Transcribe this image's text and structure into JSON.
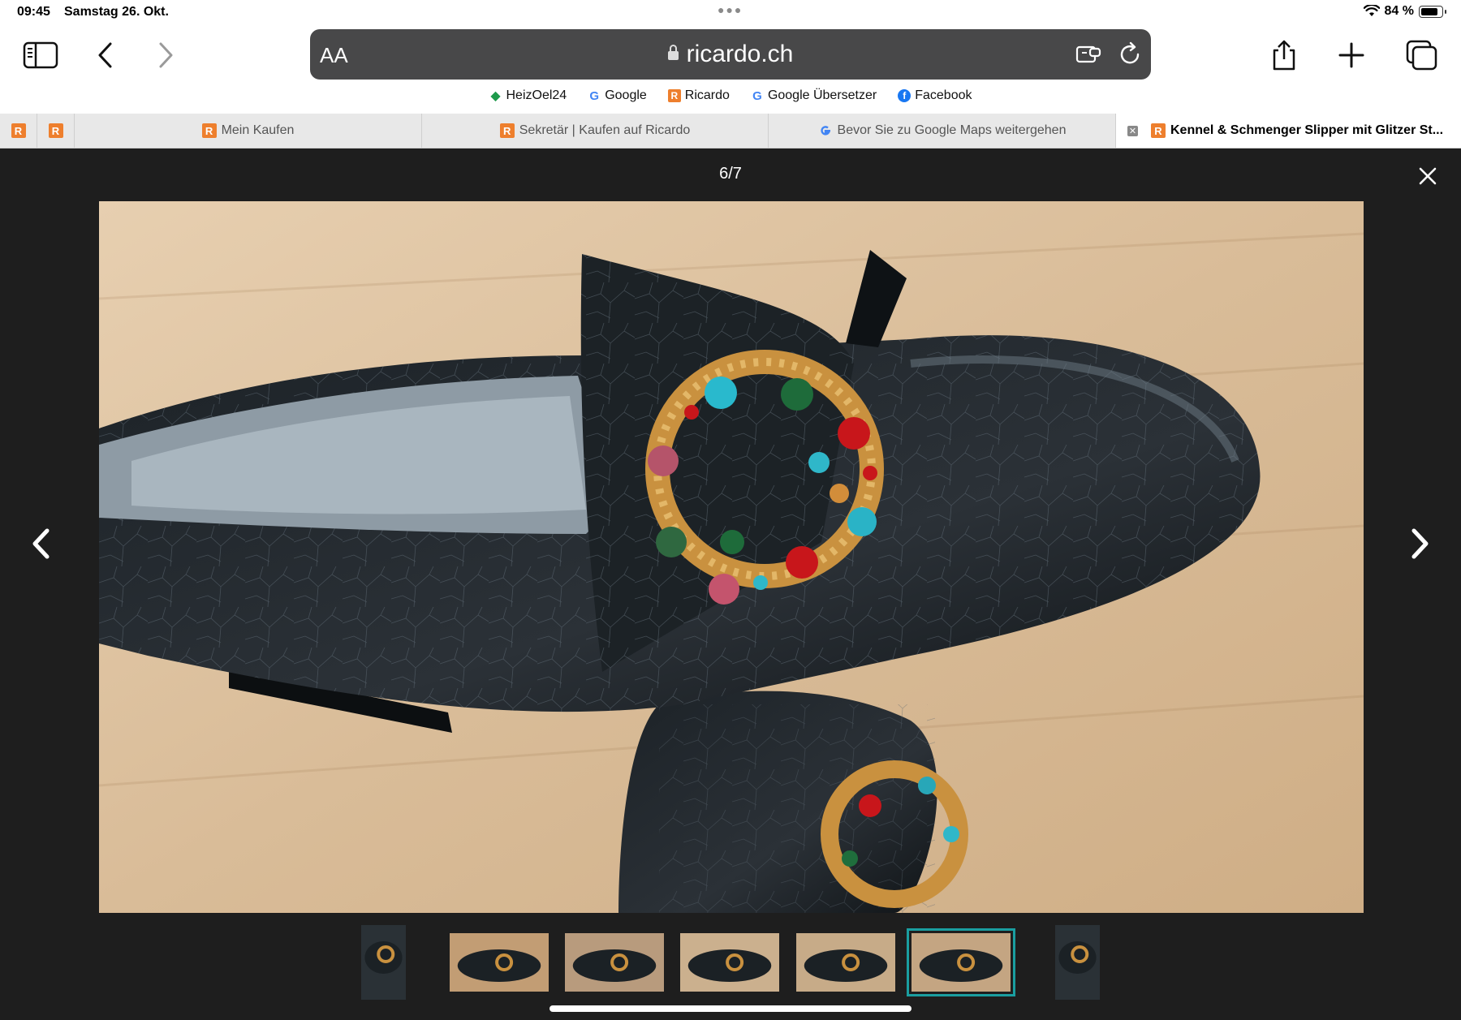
{
  "status": {
    "time": "09:45",
    "date": "Samstag 26. Okt.",
    "battery_text": "84 %",
    "battery_level": 0.84
  },
  "toolbar": {
    "reader_label": "AA",
    "url": "ricardo.ch"
  },
  "bookmarks": [
    {
      "label": "HeizOel24",
      "icon": "heizoel-icon",
      "color": "#1e9a4b"
    },
    {
      "label": "Google",
      "icon": "google-icon",
      "color": "#4285f4"
    },
    {
      "label": "Ricardo",
      "icon": "ricardo-icon",
      "color": "#ee7f2d"
    },
    {
      "label": "Google Übersetzer",
      "icon": "google-translate-icon",
      "color": "#4285f4"
    },
    {
      "label": "Facebook",
      "icon": "facebook-icon",
      "color": "#1877f2"
    }
  ],
  "tabs": [
    {
      "label": "Mein Kaufen",
      "icon": "ricardo-icon"
    },
    {
      "label": "Sekretär | Kaufen auf Ricardo",
      "icon": "ricardo-icon"
    },
    {
      "label": "Bevor Sie zu Google Maps weitergehen",
      "icon": "google-icon"
    },
    {
      "label": "Kennel & Schmenger Slipper mit Glitzer St...",
      "icon": "ricardo-icon",
      "active": true
    }
  ],
  "pinned_tab_logo": "R",
  "gallery": {
    "counter": "6/7",
    "current": 6,
    "total": 7
  },
  "colors": {
    "accent_selected": "#1a9ea0",
    "ricardo_orange": "#ee7f2d",
    "viewer_bg": "#1e1e1e"
  }
}
